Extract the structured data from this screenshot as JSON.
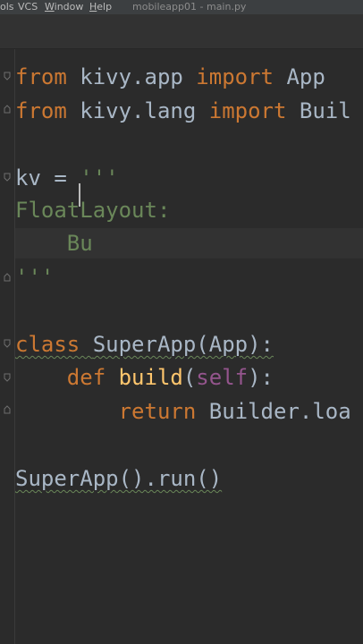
{
  "menubar": {
    "items": [
      {
        "label": "ols",
        "underline": ""
      },
      {
        "label": "VCS",
        "underline": ""
      },
      {
        "label": "Window",
        "underline": "W"
      },
      {
        "label": "Help",
        "underline": "H"
      }
    ],
    "file_title": "mobileapp01 - main.py"
  },
  "editor": {
    "lines": [
      {
        "tokens": [
          {
            "t": "from ",
            "c": "kw"
          },
          {
            "t": "kivy.app ",
            "c": "id"
          },
          {
            "t": "import ",
            "c": "kw"
          },
          {
            "t": "App",
            "c": "id"
          }
        ]
      },
      {
        "tokens": [
          {
            "t": "from ",
            "c": "kw"
          },
          {
            "t": "kivy.lang ",
            "c": "id"
          },
          {
            "t": "import ",
            "c": "kw"
          },
          {
            "t": "Buil",
            "c": "id"
          }
        ]
      },
      {
        "tokens": []
      },
      {
        "tokens": [
          {
            "t": "kv = ",
            "c": "id"
          },
          {
            "t": "'''",
            "c": "str"
          }
        ]
      },
      {
        "tokens": [
          {
            "t": "FloatLayout:",
            "c": "str"
          }
        ]
      },
      {
        "tokens": [
          {
            "t": "    Bu",
            "c": "str"
          }
        ]
      },
      {
        "tokens": [
          {
            "t": "'''",
            "c": "str"
          }
        ]
      },
      {
        "tokens": []
      },
      {
        "tokens": [
          {
            "t": "class ",
            "c": "kw squig"
          },
          {
            "t": "SuperApp(App):",
            "c": "id squig"
          }
        ]
      },
      {
        "tokens": [
          {
            "t": "    ",
            "c": "id"
          },
          {
            "t": "def ",
            "c": "kw"
          },
          {
            "t": "build",
            "c": "fn"
          },
          {
            "t": "(",
            "c": "id"
          },
          {
            "t": "self",
            "c": "self"
          },
          {
            "t": "):",
            "c": "id"
          }
        ]
      },
      {
        "tokens": [
          {
            "t": "        ",
            "c": "id"
          },
          {
            "t": "return ",
            "c": "kw"
          },
          {
            "t": "Builder.loa",
            "c": "id"
          }
        ]
      },
      {
        "tokens": []
      },
      {
        "tokens": [
          {
            "t": "SuperApp().run()",
            "c": "id squig"
          }
        ]
      }
    ]
  },
  "colors": {
    "background": "#2b2b2b",
    "keyword": "#cc7832",
    "identifier": "#a9b7c6",
    "function": "#ffc66d",
    "self": "#94558d",
    "string": "#6a8759"
  },
  "icons": [
    "fold-marker-icon"
  ]
}
